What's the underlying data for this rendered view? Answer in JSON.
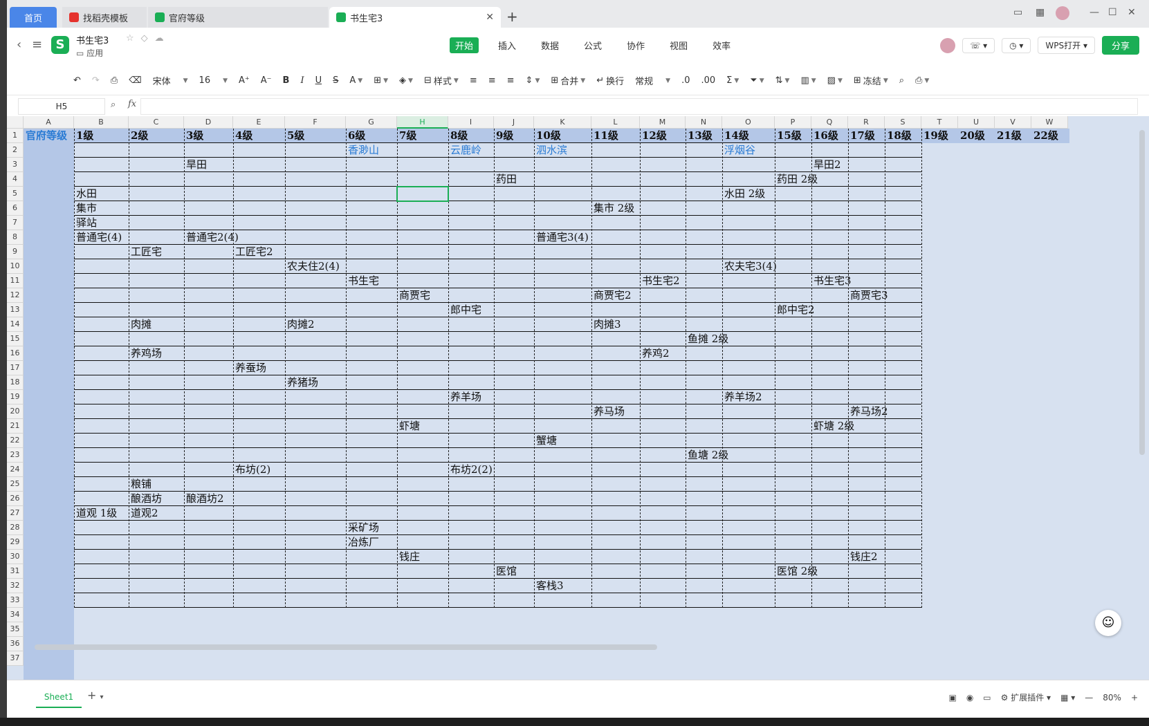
{
  "tabs": [
    {
      "label": "首页",
      "kind": "home"
    },
    {
      "label": "找稻壳模板",
      "kind": "daoke"
    },
    {
      "label": "官府等级",
      "kind": "sheet"
    },
    {
      "label": "书生宅3",
      "kind": "sheet",
      "active": true
    }
  ],
  "header": {
    "doc_name": "书生宅3",
    "folder": "应用",
    "logo_letter": "S",
    "menu_tabs": [
      "开始",
      "插入",
      "数据",
      "公式",
      "协作",
      "视图",
      "效率"
    ],
    "active_menu": "开始",
    "wps_open": "WPS打开",
    "share": "分享"
  },
  "toolbar": {
    "font": "宋体",
    "font_size": "16",
    "style": "样式",
    "merge": "合并",
    "wrap": "换行",
    "number_format": "常规",
    "freeze": "冻结"
  },
  "formula": {
    "name_box": "H5",
    "value": ""
  },
  "columns": [
    "A",
    "B",
    "C",
    "D",
    "E",
    "F",
    "G",
    "H",
    "I",
    "J",
    "K",
    "L",
    "M",
    "N",
    "O",
    "P",
    "Q",
    "R",
    "S",
    "T",
    "U",
    "V",
    "W"
  ],
  "selected_column": "H",
  "rows": [
    1,
    2,
    3,
    4,
    5,
    6,
    7,
    8,
    9,
    10,
    11,
    12,
    13,
    14,
    15,
    16,
    17,
    18,
    19,
    20,
    21,
    22,
    23,
    24,
    25,
    26,
    27,
    28,
    29,
    30,
    31,
    32,
    33,
    34,
    35,
    36,
    37
  ],
  "header_row": {
    "A": "官府等级",
    "B": "1级",
    "C": "2级",
    "D": "3级",
    "E": "4级",
    "F": "5级",
    "G": "6级",
    "H": "7级",
    "I": "8级",
    "J": "9级",
    "K": "10级",
    "L": "11级",
    "M": "12级",
    "N": "13级",
    "O": "14级",
    "P": "15级",
    "Q": "16级",
    "R": "17级",
    "S": "18级",
    "T": "19级",
    "U": "20级",
    "V": "21级",
    "W": "22级"
  },
  "cells": [
    {
      "r": 2,
      "c": "G",
      "v": "香渺山",
      "blue": true
    },
    {
      "r": 2,
      "c": "I",
      "v": "云鹿岭",
      "blue": true
    },
    {
      "r": 2,
      "c": "K",
      "v": "泗水滨",
      "blue": true
    },
    {
      "r": 2,
      "c": "O",
      "v": "浮烟谷",
      "blue": true
    },
    {
      "r": 3,
      "c": "D",
      "v": "旱田"
    },
    {
      "r": 3,
      "c": "Q",
      "v": "旱田2"
    },
    {
      "r": 4,
      "c": "J",
      "v": "药田"
    },
    {
      "r": 4,
      "c": "P",
      "v": "药田 2级"
    },
    {
      "r": 5,
      "c": "B",
      "v": "水田"
    },
    {
      "r": 5,
      "c": "O",
      "v": "水田 2级"
    },
    {
      "r": 6,
      "c": "B",
      "v": "集市"
    },
    {
      "r": 6,
      "c": "L",
      "v": "集市 2级"
    },
    {
      "r": 7,
      "c": "B",
      "v": "驿站"
    },
    {
      "r": 8,
      "c": "B",
      "v": "普通宅(4)"
    },
    {
      "r": 8,
      "c": "D",
      "v": "普通宅2(4)"
    },
    {
      "r": 8,
      "c": "K",
      "v": "普通宅3(4)"
    },
    {
      "r": 9,
      "c": "C",
      "v": "工匠宅"
    },
    {
      "r": 9,
      "c": "E",
      "v": "工匠宅2"
    },
    {
      "r": 10,
      "c": "F",
      "v": "农夫住2(4)"
    },
    {
      "r": 10,
      "c": "O",
      "v": "农夫宅3(4)"
    },
    {
      "r": 11,
      "c": "G",
      "v": "书生宅"
    },
    {
      "r": 11,
      "c": "M",
      "v": "书生宅2"
    },
    {
      "r": 11,
      "c": "Q",
      "v": "书生宅3"
    },
    {
      "r": 12,
      "c": "H",
      "v": "商贾宅"
    },
    {
      "r": 12,
      "c": "L",
      "v": "商贾宅2"
    },
    {
      "r": 12,
      "c": "R",
      "v": "商贾宅3"
    },
    {
      "r": 13,
      "c": "I",
      "v": "郎中宅"
    },
    {
      "r": 13,
      "c": "P",
      "v": "郎中宅2"
    },
    {
      "r": 14,
      "c": "C",
      "v": "肉摊"
    },
    {
      "r": 14,
      "c": "F",
      "v": "肉摊2"
    },
    {
      "r": 14,
      "c": "L",
      "v": "肉摊3"
    },
    {
      "r": 15,
      "c": "N",
      "v": "鱼摊 2级"
    },
    {
      "r": 16,
      "c": "C",
      "v": "养鸡场"
    },
    {
      "r": 16,
      "c": "M",
      "v": "养鸡2"
    },
    {
      "r": 17,
      "c": "E",
      "v": "养蚕场"
    },
    {
      "r": 18,
      "c": "F",
      "v": "养猪场"
    },
    {
      "r": 19,
      "c": "I",
      "v": "养羊场"
    },
    {
      "r": 19,
      "c": "O",
      "v": "养羊场2"
    },
    {
      "r": 20,
      "c": "L",
      "v": "养马场"
    },
    {
      "r": 20,
      "c": "R",
      "v": "养马场2"
    },
    {
      "r": 21,
      "c": "H",
      "v": "虾塘"
    },
    {
      "r": 21,
      "c": "Q",
      "v": "虾塘 2级"
    },
    {
      "r": 22,
      "c": "K",
      "v": "蟹塘"
    },
    {
      "r": 23,
      "c": "N",
      "v": "鱼塘 2级"
    },
    {
      "r": 24,
      "c": "E",
      "v": "布坊(2)"
    },
    {
      "r": 24,
      "c": "I",
      "v": "布坊2(2)"
    },
    {
      "r": 25,
      "c": "C",
      "v": "粮铺"
    },
    {
      "r": 26,
      "c": "C",
      "v": "酿酒坊"
    },
    {
      "r": 26,
      "c": "D",
      "v": "酿酒坊2"
    },
    {
      "r": 27,
      "c": "B",
      "v": "道观 1级"
    },
    {
      "r": 27,
      "c": "C",
      "v": "道观2"
    },
    {
      "r": 28,
      "c": "G",
      "v": "采矿场"
    },
    {
      "r": 29,
      "c": "G",
      "v": "冶炼厂"
    },
    {
      "r": 30,
      "c": "H",
      "v": "钱庄"
    },
    {
      "r": 30,
      "c": "R",
      "v": "钱庄2"
    },
    {
      "r": 31,
      "c": "J",
      "v": "医馆"
    },
    {
      "r": 31,
      "c": "P",
      "v": "医馆 2级"
    },
    {
      "r": 32,
      "c": "K",
      "v": "客栈3"
    }
  ],
  "status": {
    "sheet_name": "Sheet1",
    "plugins": "扩展插件",
    "zoom": "80%"
  }
}
